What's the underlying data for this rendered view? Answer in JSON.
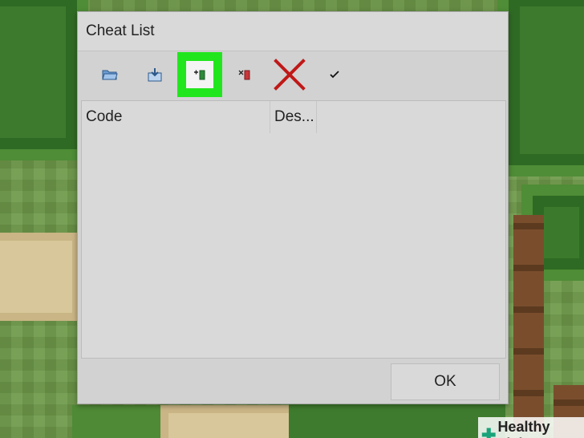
{
  "window": {
    "title": "Cheat List"
  },
  "toolbar": {
    "buttons": [
      {
        "name": "open-folder",
        "icon": "folder-open-icon"
      },
      {
        "name": "import",
        "icon": "import-icon"
      },
      {
        "name": "add-cheat",
        "icon": "add-bookmark-icon",
        "highlighted": true,
        "highlight_color": "#22e61d"
      },
      {
        "name": "remove-cheat",
        "icon": "remove-bookmark-icon"
      },
      {
        "name": "delete",
        "icon": "red-x-icon",
        "color": "#c01818"
      },
      {
        "name": "apply",
        "icon": "checkmark-icon"
      }
    ]
  },
  "list": {
    "columns": [
      "Code",
      "Des..."
    ],
    "rows": []
  },
  "footer": {
    "ok_label": "OK"
  },
  "watermark": {
    "text": "Healthy Living"
  }
}
